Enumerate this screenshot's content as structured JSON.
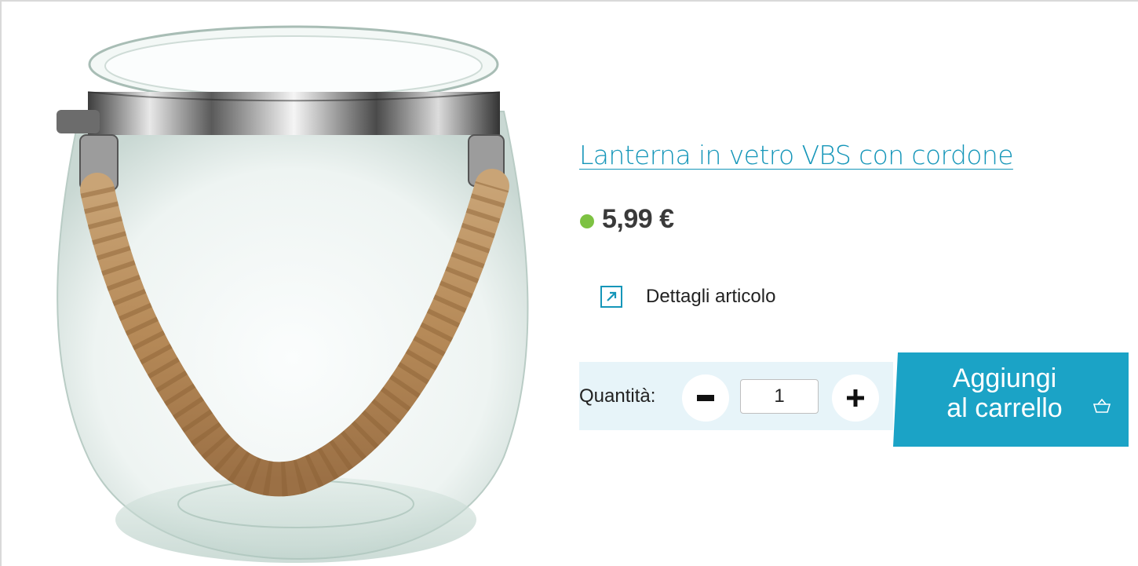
{
  "product": {
    "title": "Lanterna in vetro VBS con cordone",
    "price": "5,99 €",
    "stock_status_color": "#7dc242",
    "details_link_label": "Dettagli articolo",
    "details_icon": "external-arrow-icon"
  },
  "quantity": {
    "label": "Quantità:",
    "value": "1",
    "minus_icon": "minus-icon",
    "plus_icon": "plus-icon"
  },
  "cart": {
    "button_label": "Aggiungi\nal carrello",
    "icon": "basket-icon"
  },
  "colors": {
    "accent": "#1ba3c6",
    "link": "#1596b9",
    "quantity_background": "#e7f4f9"
  }
}
